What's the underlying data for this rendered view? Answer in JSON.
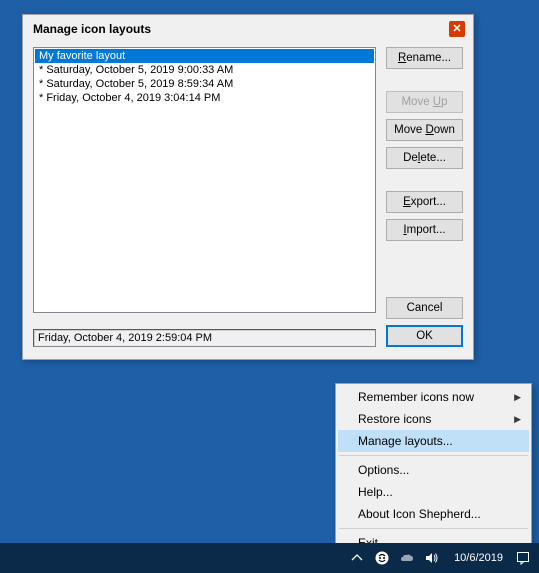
{
  "dialog": {
    "title": "Manage icon layouts",
    "list": [
      "My favorite layout",
      "* Saturday, October 5, 2019 9:00:33 AM",
      "* Saturday, October 5, 2019 8:59:34 AM",
      "* Friday, October 4, 2019 3:04:14 PM"
    ],
    "selected_index": 0,
    "status": "Friday, October 4, 2019 2:59:04 PM",
    "buttons": {
      "rename": "Rename...",
      "moveup": "Move Up",
      "movedown": "Move Down",
      "delete": "Delete...",
      "export": "Export...",
      "import": "Import...",
      "cancel": "Cancel",
      "ok": "OK"
    }
  },
  "context_menu": {
    "items": [
      {
        "label": "Remember icons now",
        "submenu": true
      },
      {
        "label": "Restore icons",
        "submenu": true
      },
      {
        "label": "Manage layouts...",
        "highlight": true
      },
      {
        "sep": true
      },
      {
        "label": "Options..."
      },
      {
        "label": "Help..."
      },
      {
        "label": "About Icon Shepherd..."
      },
      {
        "sep": true
      },
      {
        "label": "Exit"
      }
    ]
  },
  "taskbar": {
    "date": "10/6/2019"
  }
}
